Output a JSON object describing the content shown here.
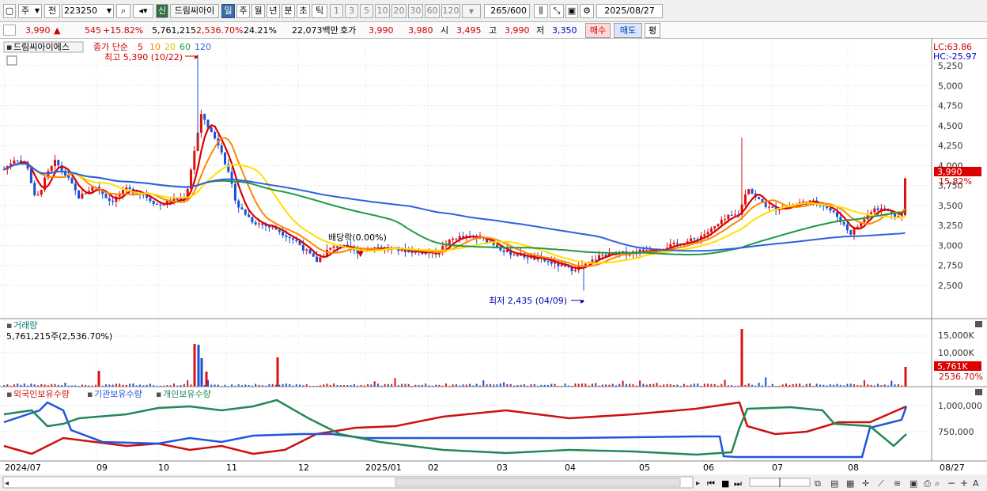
{
  "toolbar": {
    "market_type": "주",
    "prev_label": "전",
    "stock_code": "223250",
    "stock_name_tag": "신",
    "stock_name": "드림씨아이",
    "periods": [
      "일",
      "주",
      "월",
      "년",
      "분",
      "초",
      "틱"
    ],
    "intervals": [
      "1",
      "3",
      "5",
      "10",
      "20",
      "30",
      "60",
      "120"
    ],
    "count_value": "265",
    "count_total": "/600",
    "date": "2025/08/27"
  },
  "quote": {
    "price": "3,990",
    "change_arrow": "▲",
    "change": "545",
    "change_pct": "+15.82%",
    "volume": "5,761,215",
    "volume_ratio": "2,536.70%",
    "turnover": "24.21%",
    "amount": "22,073백만",
    "bid_label": "호가",
    "ask": "3,990",
    "bid": "3,980",
    "open_label": "시",
    "open": "3,495",
    "high_label": "고",
    "high": "3,990",
    "low_label": "저",
    "low": "3,350",
    "buy_label": "매수",
    "sell_label": "매도",
    "eval_label": "평"
  },
  "price_panel": {
    "title": "드림씨아이에스",
    "legend_prefix": "종가 단순",
    "ma_periods": [
      "5",
      "10",
      "20",
      "60",
      "120"
    ],
    "ma_colors": [
      "#dd0000",
      "#ff8800",
      "#ffe000",
      "#229944",
      "#3060e0"
    ],
    "high_annotation": "최고 5,390 (10/22)",
    "low_annotation": "최저 2,435 (04/09)",
    "dividend_annotation": "배당락(0.00%)",
    "lc_label": "LC:63.86",
    "hc_label": "HC:-25.97",
    "y_ticks": [
      "5,250",
      "5,000",
      "4,750",
      "4,500",
      "4,250",
      "4,000",
      "3,750",
      "3,500",
      "3,250",
      "3,000",
      "2,750",
      "2,500"
    ],
    "last_price_label": "3,990",
    "last_pct_label": "15.82%"
  },
  "volume_panel": {
    "title": "거래량",
    "summary": "5,761,215주(2,536.70%)",
    "y_ticks": [
      "15,000K",
      "10,000K"
    ],
    "last_label": "5,761K",
    "last_pct": "2536.70%"
  },
  "holdings_panel": {
    "legend": [
      "외국인보유수량",
      "기관보유수량",
      "개인보유수량"
    ],
    "colors": [
      "#cc1111",
      "#2255dd",
      "#228855"
    ],
    "y_ticks": [
      "1,000,000",
      "750,000"
    ]
  },
  "x_axis": {
    "labels": [
      "2024/07",
      "09",
      "10",
      "11",
      "12",
      "2025/01",
      "02",
      "03",
      "04",
      "05",
      "06",
      "07",
      "08",
      "08/27"
    ]
  },
  "icons": {
    "chart_type": "candle-chart-icon",
    "settings": "gear-icon",
    "save": "save-icon",
    "search": "search-icon",
    "sound": "speaker-icon"
  }
}
